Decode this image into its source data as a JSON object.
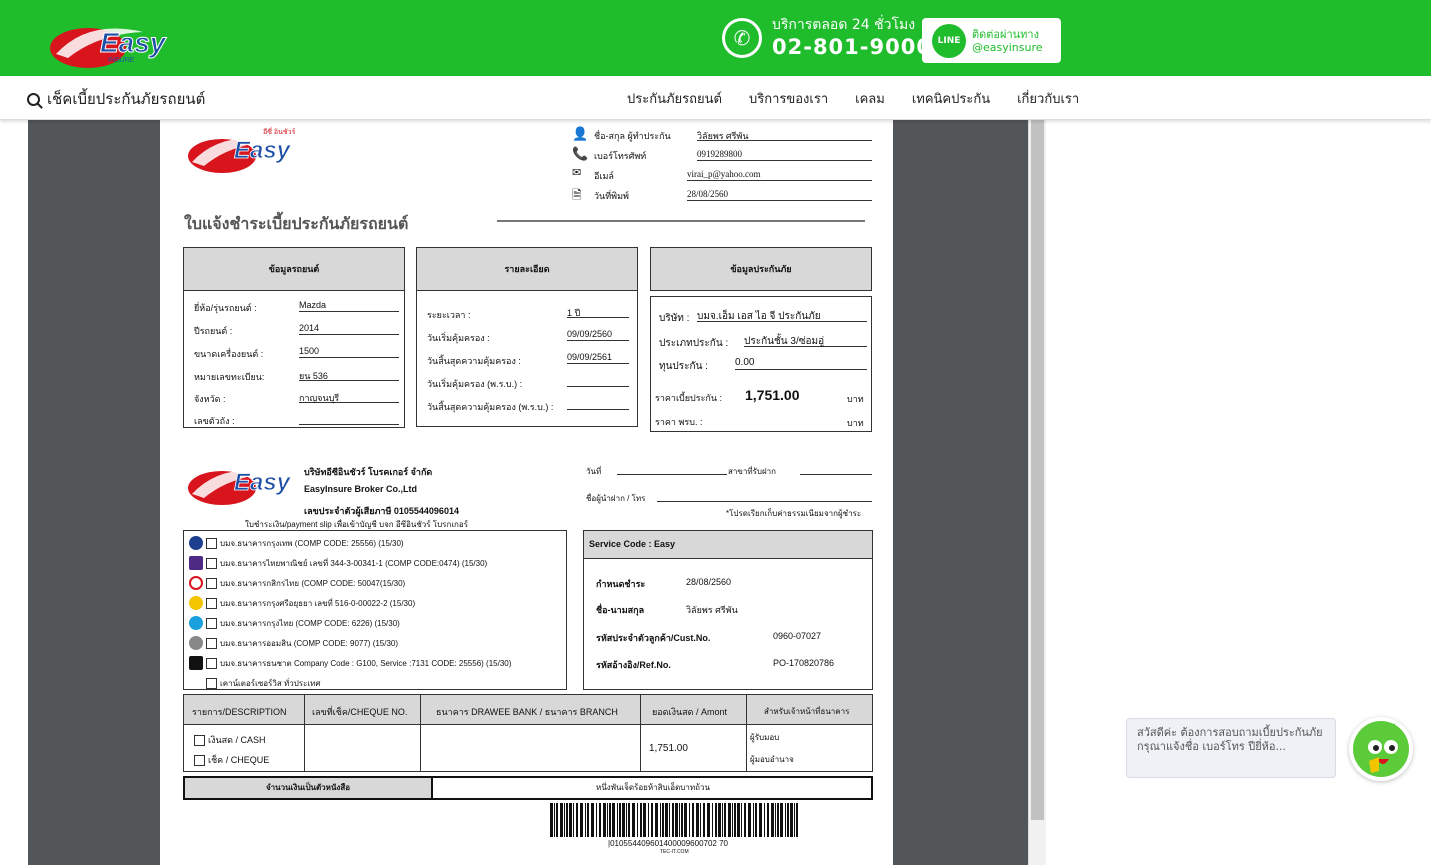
{
  "header": {
    "logo_text": "Easy",
    "logo_sub": "INSURE",
    "logo_thai": "อีซี่ อินชัวร์",
    "service_caption": "บริการตลอด 24 ชั่วโมง",
    "phone": "02-801-9000",
    "line_badge": "LINE",
    "line_caption": "ติดต่อผ่านทาง",
    "line_id": "@easyinsure"
  },
  "nav": {
    "check_premium": "เช็คเบี้ยประกันภัยรถยนต์",
    "items": [
      "ประกันภัยรถยนต์",
      "บริการของเรา",
      "เคลม",
      "เทคนิคประกัน",
      "เกี่ยวกับเรา"
    ]
  },
  "doc": {
    "contact": {
      "name_label": "ชื่อ-สกุล ผู้ทำประกัน",
      "name": "วิลัยพร ศรีพัน",
      "phone_label": "เบอร์โทรศัพท์",
      "phone": "0919289800",
      "email_label": "อีเมล์",
      "email": "virai_p@yahoo.com",
      "date_label": "วันที่พิมพ์",
      "date": "28/08/2560"
    },
    "title": "ใบแจ้งชำระเบี้ยประกันภัยรถยนต์",
    "car_box": {
      "header": "ข้อมูลรถยนต์",
      "rows": [
        {
          "label": "ยี่ห้อ/รุ่นรถยนต์ :",
          "value": "Mazda"
        },
        {
          "label": "ปีรถยนต์ :",
          "value": "2014"
        },
        {
          "label": "ขนาดเครื่องยนต์ :",
          "value": "1500"
        },
        {
          "label": "หมายเลขทะเบียน:",
          "value": "ยน 536"
        },
        {
          "label": "จังหวัด :",
          "value": "กาญจนบุรี"
        },
        {
          "label": "เลขตัวถัง :",
          "value": ""
        }
      ]
    },
    "detail_box": {
      "header": "รายละเอียด",
      "rows": [
        {
          "label": "ระยะเวลา :",
          "value": "1 ปี"
        },
        {
          "label": "วันเริ่มคุ้มครอง :",
          "value": "09/09/2560"
        },
        {
          "label": "วันสิ้นสุดความคุ้มครอง :",
          "value": "09/09/2561"
        },
        {
          "label": "วันเริ่มคุ้มครอง (พ.ร.บ.) :",
          "value": ""
        },
        {
          "label": "วันสิ้นสุดความคุ้มครอง (พ.ร.บ.) :",
          "value": ""
        }
      ]
    },
    "insurance_box": {
      "header": "ข้อมูลประกันภัย",
      "company_label": "บริษัท :",
      "company": "บมจ.เอ็ม เอส ไอ จี ประกันภัย",
      "type_label": "ประเภทประกัน :",
      "type": "ประกันชั้น 3/ซ่อมอู่",
      "sum_label": "ทุนประกัน :",
      "sum": "0.00",
      "premium_label": "ราคาเบี้ยประกัน :",
      "premium": "1,751.00",
      "baht": "บาท",
      "prb_label": "ราคา พรบ. :",
      "prb_baht": "บาท"
    },
    "slip": {
      "company_th": "บริษัทอีซีอินชัวร์ โบรคเกอร์ จำกัด",
      "company_en": "EasyInsure Broker Co.,Ltd",
      "tax_id": "เลขประจำตัวผู้เสียภาษี 0105544096014",
      "slip_note": "ใบชำระเงิน/payment slip เพื่อเข้าบัญชี บจก อีซีอินชัวร์ โบรกเกอร์",
      "date_label": "วันที่",
      "branch_label": "สาขาที่รับฝาก",
      "depositor_label": "ชื่อผู้นำฝาก / โทร",
      "fee_note": "*โปรดเรียกเก็บค่าธรรมเนียมจากผู้ชำระ",
      "banks": [
        {
          "text": "บมจ.ธนาคารกรุงเทพ (COMP CODE: 25556) (15/30)",
          "color": "#1e3f8f"
        },
        {
          "text": "บมจ.ธนาคารไทยพาณิชย์ เลขที่ 344-3-00341-1 (COMP CODE:0474) (15/30)",
          "color": "#4e2a84"
        },
        {
          "text": "บมจ.ธนาคารกสิกรไทย (COMP CODE: 50047(15/30)",
          "color": "#138f2d"
        },
        {
          "text": "บมจ.ธนาคารกรุงศรีอยุธยา เลขที่ 516-0-00022-2 (15/30)",
          "color": "#f2c500"
        },
        {
          "text": "บมจ.ธนาคารกรุงไทย (COMP CODE: 6226) (15/30)",
          "color": "#1aa0dc"
        },
        {
          "text": "บมจ.ธนาคารออมสิน (COMP CODE: 9077) (15/30)",
          "color": "#888888"
        },
        {
          "text": "บมจ.ธนาคารธนชาต Company Code : G100, Service :7131 CODE: 25556) (15/30)",
          "color": "#111111"
        },
        {
          "text": "เคาน์เตอร์เซอร์วิส ทั่วประเทศ",
          "color": ""
        }
      ],
      "service_code": "Service Code : Easy",
      "due_label": "กำหนดชำระ",
      "due": "28/08/2560",
      "payer_label": "ชื่อ-นามสกุล",
      "payer": "วิลัยพร ศรีพัน",
      "cust_label": "รหัสประจำตัวลูกค้า/Cust.No.",
      "cust": "0960-07027",
      "ref_label": "รหัสอ้างอิง/Ref.No.",
      "ref": "PO-170820786"
    },
    "pay_table": {
      "headers": [
        "รายการ/DESCRIPTION",
        "เลขที่เช็ค/CHEQUE NO.",
        "ธนาคาร DRAWEE BANK / ธนาคาร BRANCH",
        "ยอดเงินสด / Amont",
        "สำหรับเจ้าหน้าที่ธนาคาร"
      ],
      "cash": "เงินสด / CASH",
      "cheque": "เช็ค / CHEQUE",
      "amount": "1,751.00",
      "receiver": "ผู้รับมอบ",
      "authorizer": "ผู้มอบอำนาจ",
      "words_label": "จำนวนเงินเป็นตัวหนังสือ",
      "words": "หนึ่งพันเจ็ดร้อยห้าสิบเอ็ดบาทถ้วน"
    },
    "barcode_text": "|010554409601400009600702 70",
    "barcode_credit": "TEC-IT.COM"
  },
  "chat": {
    "message": "สวัสดีค่ะ ต้องการสอบถามเบี้ยประกันภัย กรุณาแจ้งชื่อ เบอร์โทร ปียี่ห้อ..."
  }
}
